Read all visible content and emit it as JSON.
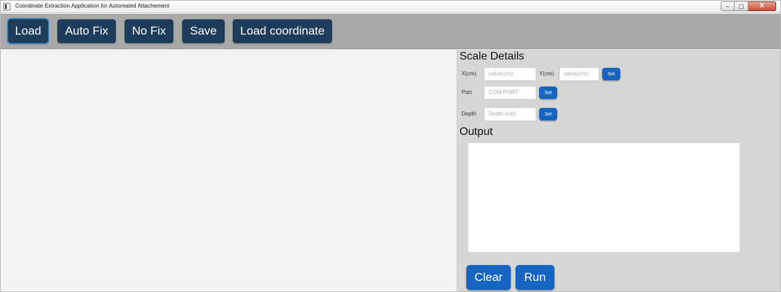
{
  "window": {
    "title": "Coordinate Extraction Application for Automated Attachement",
    "controls": {
      "minimize": "–",
      "maximize": "▢",
      "close": "X"
    }
  },
  "toolbar": {
    "load": "Load",
    "auto_fix": "Auto Fix",
    "no_fix": "No Fix",
    "save": "Save",
    "load_coordinate": "Load coordinate"
  },
  "scale": {
    "heading": "Scale Details",
    "x_label": "X(cm)",
    "x_placeholder": "value(cm)",
    "y_label": "Y(cm)",
    "y_placeholder": "value(cm)",
    "set_label": "Set",
    "port_label": "Port",
    "port_placeholder": "COM PORT",
    "depth_label": "Depth",
    "depth_placeholder": "Depth (cm)"
  },
  "output": {
    "heading": "Output",
    "value": ""
  },
  "actions": {
    "clear": "Clear",
    "run": "Run"
  },
  "colors": {
    "toolbar_button": "#1e3d5c",
    "accent_button": "#1565c0",
    "toolbar_bg": "#a9a9a9",
    "panel_bg": "#d6d6d6"
  }
}
